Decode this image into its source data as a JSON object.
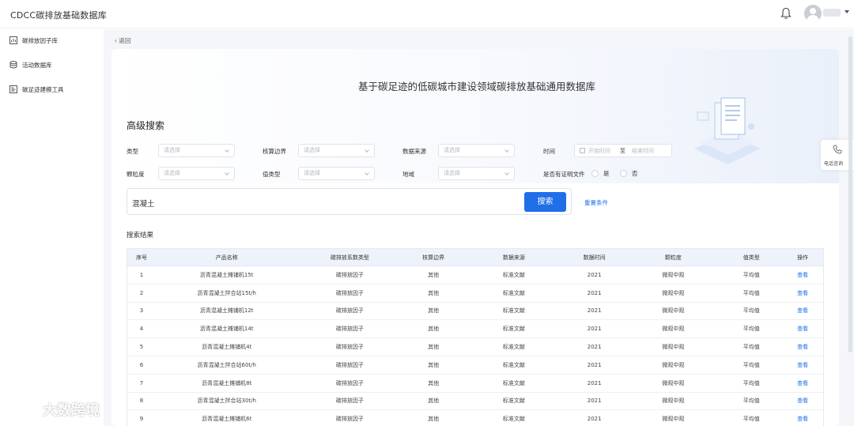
{
  "app": {
    "title": "CDCC碳排放基础数据库"
  },
  "sidebar": {
    "items": [
      {
        "label": "碳排放因子库",
        "icon": "chart-box-icon"
      },
      {
        "label": "活动数据库",
        "icon": "database-icon"
      },
      {
        "label": "碳足迹建模工具",
        "icon": "modeling-tool-icon"
      }
    ]
  },
  "nav": {
    "back_label": "返回"
  },
  "hero": {
    "title": "基于碳足迹的低碳城市建设领域碳排放基础通用数据库"
  },
  "advanced_search": {
    "title": "高级搜索",
    "fields": {
      "type": {
        "label": "类型",
        "placeholder": "请选择"
      },
      "boundary": {
        "label": "核算边界",
        "placeholder": "请选择"
      },
      "source": {
        "label": "数据来源",
        "placeholder": "请选择"
      },
      "time": {
        "label": "时间",
        "start_placeholder": "开始时间",
        "separator": "至",
        "end_placeholder": "结束时间"
      },
      "granularity": {
        "label": "颗粒度",
        "placeholder": "请选择"
      },
      "value_type": {
        "label": "值类型",
        "placeholder": "请选择"
      },
      "region": {
        "label": "地域",
        "placeholder": "请选择"
      },
      "proof": {
        "label": "是否有证明文件",
        "yes": "是",
        "no": "否"
      }
    },
    "query": "混凝土",
    "search_label": "搜索",
    "reset_label": "重置条件"
  },
  "results": {
    "title": "搜索结果",
    "columns": [
      "序号",
      "产品名称",
      "碳排放系数类型",
      "核算边界",
      "数据来源",
      "数据时间",
      "颗粒度",
      "值类型",
      "操作"
    ],
    "action_label": "查看",
    "rows": [
      [
        "1",
        "沥青混凝土摊铺机15t",
        "碳排放因子",
        "其他",
        "标准文献",
        "2021",
        "微观中观",
        "平均值"
      ],
      [
        "2",
        "沥青混凝土拌合站15t/h",
        "碳排放因子",
        "其他",
        "标准文献",
        "2021",
        "微观中观",
        "平均值"
      ],
      [
        "3",
        "沥青混凝土摊铺机12t",
        "碳排放因子",
        "其他",
        "标准文献",
        "2021",
        "微观中观",
        "平均值"
      ],
      [
        "4",
        "沥青混凝土摊铺机14t",
        "碳排放因子",
        "其他",
        "标准文献",
        "2021",
        "微观中观",
        "平均值"
      ],
      [
        "5",
        "沥青混凝土摊铺机4t",
        "碳排放因子",
        "其他",
        "标准文献",
        "2021",
        "微观中观",
        "平均值"
      ],
      [
        "6",
        "沥青混凝土拌合站60t/h",
        "碳排放因子",
        "其他",
        "标准文献",
        "2021",
        "微观中观",
        "平均值"
      ],
      [
        "7",
        "沥青混凝土摊铺机8t",
        "碳排放因子",
        "其他",
        "标准文献",
        "2021",
        "微观中观",
        "平均值"
      ],
      [
        "8",
        "沥青混凝土拌合站30t/h",
        "碳排放因子",
        "其他",
        "标准文献",
        "2021",
        "微观中观",
        "平均值"
      ],
      [
        "9",
        "沥青混凝土摊铺机6t",
        "碳排放因子",
        "其他",
        "标准文献",
        "2021",
        "微观中观",
        "平均值"
      ]
    ]
  },
  "float": {
    "consult_label": "电话咨询"
  },
  "watermark": {
    "text": "大数跨境"
  },
  "colors": {
    "accent": "#1f6fe8",
    "header_bg": "#eef3fb",
    "page_bg": "#f4f6f9"
  }
}
